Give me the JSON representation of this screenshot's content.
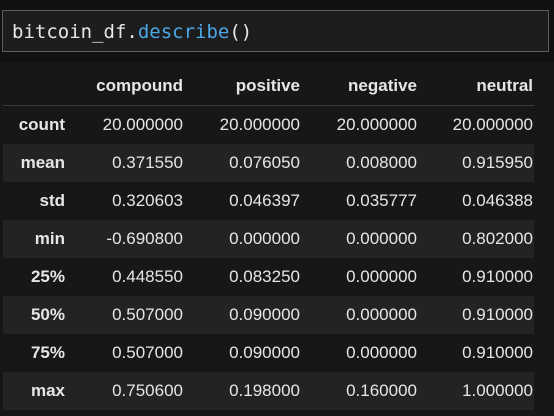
{
  "code_cell": {
    "object": "bitcoin_df",
    "dot": ".",
    "method": "describe",
    "parens": "()"
  },
  "table": {
    "columns": [
      "compound",
      "positive",
      "negative",
      "neutral"
    ],
    "rows": [
      {
        "label": "count",
        "values": [
          "20.000000",
          "20.000000",
          "20.000000",
          "20.000000"
        ]
      },
      {
        "label": "mean",
        "values": [
          "0.371550",
          "0.076050",
          "0.008000",
          "0.915950"
        ]
      },
      {
        "label": "std",
        "values": [
          "0.320603",
          "0.046397",
          "0.035777",
          "0.046388"
        ]
      },
      {
        "label": "min",
        "values": [
          "-0.690800",
          "0.000000",
          "0.000000",
          "0.802000"
        ]
      },
      {
        "label": "25%",
        "values": [
          "0.448550",
          "0.083250",
          "0.000000",
          "0.910000"
        ]
      },
      {
        "label": "50%",
        "values": [
          "0.507000",
          "0.090000",
          "0.000000",
          "0.910000"
        ]
      },
      {
        "label": "75%",
        "values": [
          "0.507000",
          "0.090000",
          "0.000000",
          "0.910000"
        ]
      },
      {
        "label": "max",
        "values": [
          "0.750600",
          "0.198000",
          "0.160000",
          "1.000000"
        ]
      }
    ]
  },
  "colors": {
    "background": "#111111",
    "code_cell_border": "#5e5e5e",
    "method_color": "#4aa8e6",
    "row_stripe": "#232323",
    "text": "#e6e6e6"
  }
}
